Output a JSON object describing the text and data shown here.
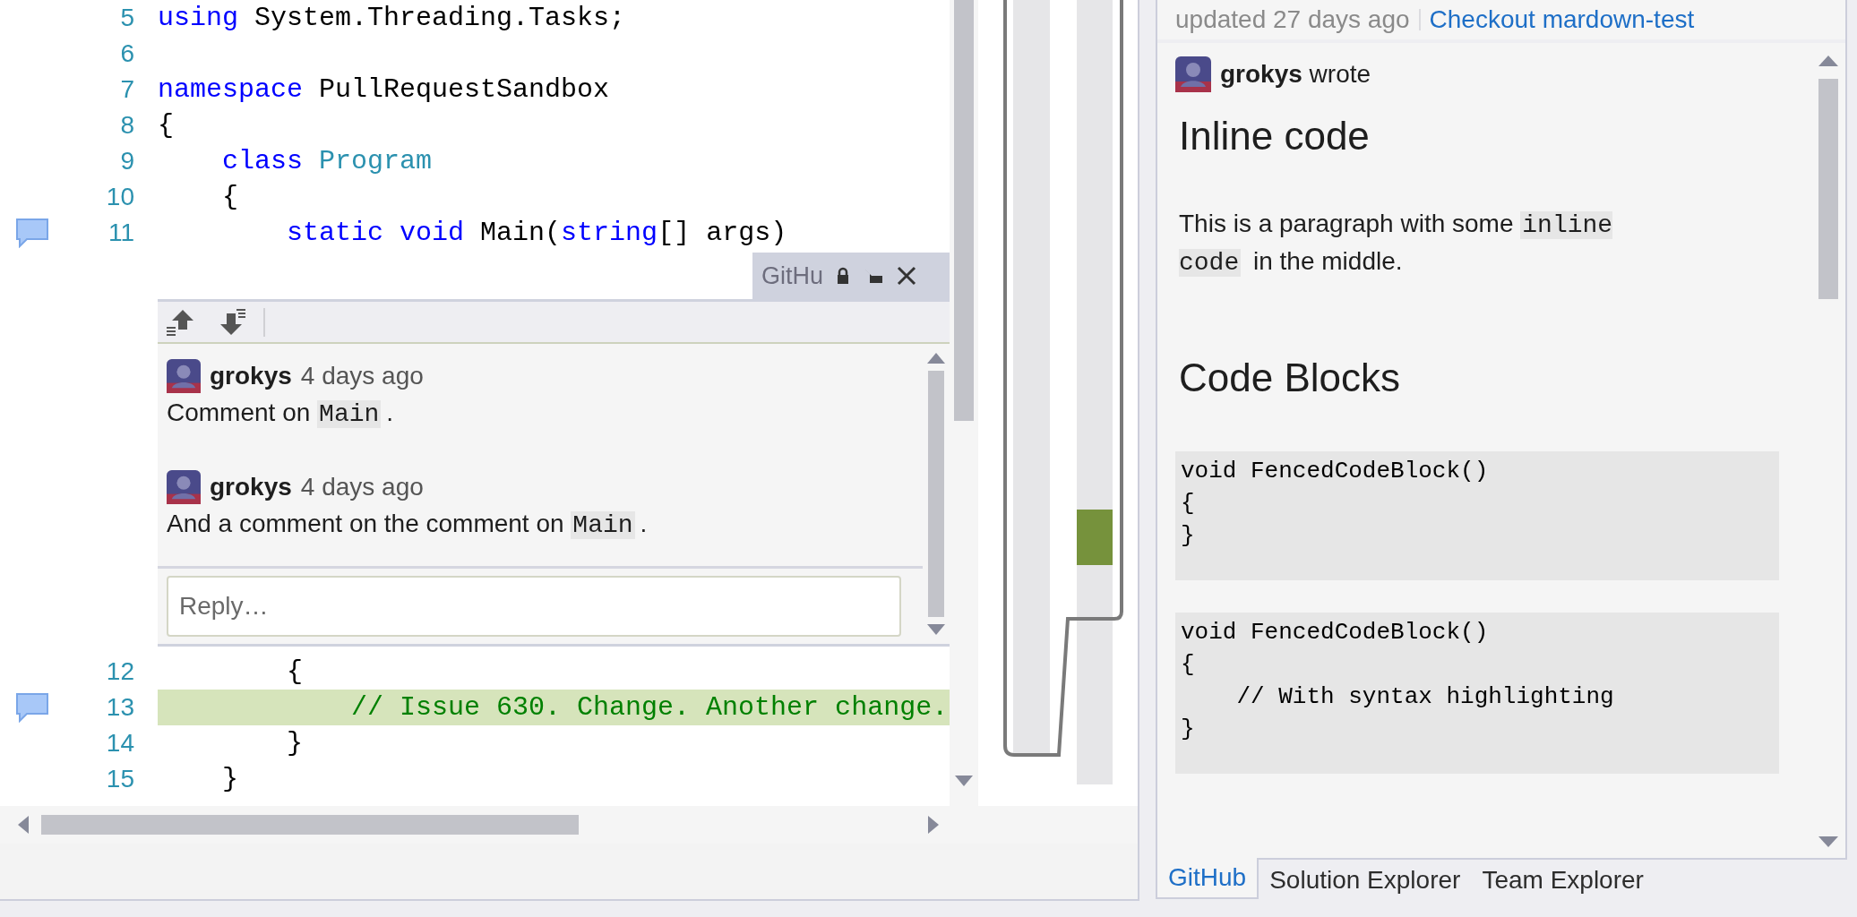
{
  "editor": {
    "lines": [
      {
        "number": "5",
        "comment_marker": false,
        "changed": false,
        "tokens": [
          {
            "kind": "keyword",
            "text": "using"
          },
          {
            "kind": "plain",
            "text": " System.Threading.Tasks;"
          }
        ]
      },
      {
        "number": "6",
        "comment_marker": false,
        "changed": false
      },
      {
        "number": "7",
        "comment_marker": false,
        "changed": false,
        "tokens": [
          {
            "kind": "keyword",
            "text": "namespace"
          },
          {
            "kind": "plain",
            "text": " PullRequestSandbox"
          }
        ]
      },
      {
        "number": "8",
        "comment_marker": false,
        "changed": false,
        "tokens": [
          {
            "kind": "plain",
            "text": "{"
          }
        ]
      },
      {
        "number": "9",
        "comment_marker": false,
        "changed": false,
        "tokens": [
          {
            "kind": "keyword",
            "text": "    class"
          },
          {
            "kind": "type",
            "text": " Program"
          }
        ]
      },
      {
        "number": "10",
        "comment_marker": false,
        "changed": false,
        "tokens": [
          {
            "kind": "plain",
            "text": "    {"
          }
        ]
      },
      {
        "number": "11",
        "comment_marker": true,
        "changed": false,
        "tokens": [
          {
            "kind": "keyword",
            "text": "        static"
          },
          {
            "kind": "keyword",
            "text": " void"
          },
          {
            "kind": "plain",
            "text": " Main("
          },
          {
            "kind": "keyword",
            "text": "string"
          },
          {
            "kind": "plain",
            "text": "[] args)"
          }
        ]
      }
    ],
    "peek": {
      "title": "GitHu",
      "comments": [
        {
          "author": "grokys",
          "time": "4 days ago",
          "body": [
            {
              "kind": "text",
              "text": "Comment on "
            },
            {
              "kind": "code",
              "text": "Main"
            },
            {
              "kind": "text",
              "text": "."
            }
          ]
        },
        {
          "author": "grokys",
          "time": "4 days ago",
          "body": [
            {
              "kind": "text",
              "text": "And a comment on the comment on "
            },
            {
              "kind": "code",
              "text": "Main"
            },
            {
              "kind": "text",
              "text": "."
            }
          ]
        }
      ],
      "reply_placeholder": "Reply…"
    },
    "lines_after": [
      {
        "number": "12",
        "comment_marker": false,
        "changed": false,
        "tokens": [
          {
            "kind": "plain",
            "text": "        {"
          }
        ]
      },
      {
        "number": "13",
        "comment_marker": true,
        "changed": true,
        "tokens": [
          {
            "kind": "comment",
            "text": "            // Issue 630. Change. Another change."
          }
        ]
      },
      {
        "number": "14",
        "comment_marker": false,
        "changed": false,
        "tokens": [
          {
            "kind": "plain",
            "text": "        }"
          }
        ]
      },
      {
        "number": "15",
        "comment_marker": false,
        "changed": false,
        "tokens": [
          {
            "kind": "plain",
            "text": "    }"
          }
        ]
      }
    ]
  },
  "github_pane": {
    "updated": "updated 27 days ago",
    "checkout_link": "Checkout mardown-test",
    "author": "grokys",
    "verb": "wrote",
    "blocks": [
      {
        "kind": "heading",
        "text": "Inline code"
      },
      {
        "kind": "paragraph",
        "parts": [
          {
            "kind": "text",
            "text": "This is a paragraph with some "
          },
          {
            "kind": "code",
            "text": "inline code"
          },
          {
            "kind": "text",
            "text": " in the middle."
          }
        ]
      },
      {
        "kind": "heading",
        "text": "Code Blocks"
      },
      {
        "kind": "code_block",
        "lines": [
          "void FencedCodeBlock()",
          "{",
          "}"
        ]
      },
      {
        "kind": "code_block",
        "lines": [
          "void FencedCodeBlock()",
          "{",
          "    // With syntax highlighting",
          "}"
        ]
      }
    ]
  },
  "tabs": [
    {
      "label": "GitHub",
      "selected": true
    },
    {
      "label": "Solution Explorer",
      "selected": false
    },
    {
      "label": "Team Explorer",
      "selected": false
    }
  ]
}
